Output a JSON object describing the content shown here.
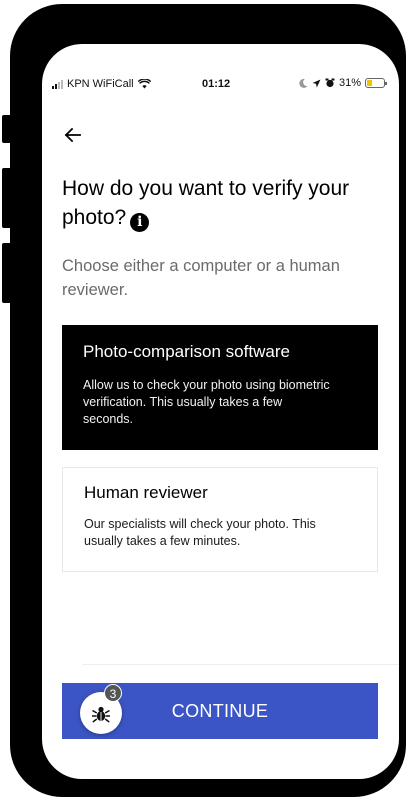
{
  "status_bar": {
    "carrier": "KPN WiFiCall",
    "time": "01:12",
    "battery": "31%",
    "battery_level": 0.31
  },
  "page": {
    "title": "How do you want to verify your photo?",
    "subtitle": "Choose either a computer or a human reviewer."
  },
  "options": [
    {
      "title": "Photo-comparison software",
      "description": "Allow us to check your photo using biometric verification. This usually takes a few seconds.",
      "selected": true
    },
    {
      "title": "Human reviewer",
      "description": "Our specialists will check your photo. This usually takes a few minutes.",
      "selected": false
    }
  ],
  "actions": {
    "continue_label": "CONTINUE"
  },
  "debug": {
    "badge_count": "3"
  },
  "colors": {
    "accent": "#3b55c6",
    "selected_bg": "#000000",
    "subtitle": "#6b6b6b"
  },
  "icons": {
    "back": "arrow-left-icon",
    "info": "info-icon",
    "debug": "bug-icon"
  }
}
